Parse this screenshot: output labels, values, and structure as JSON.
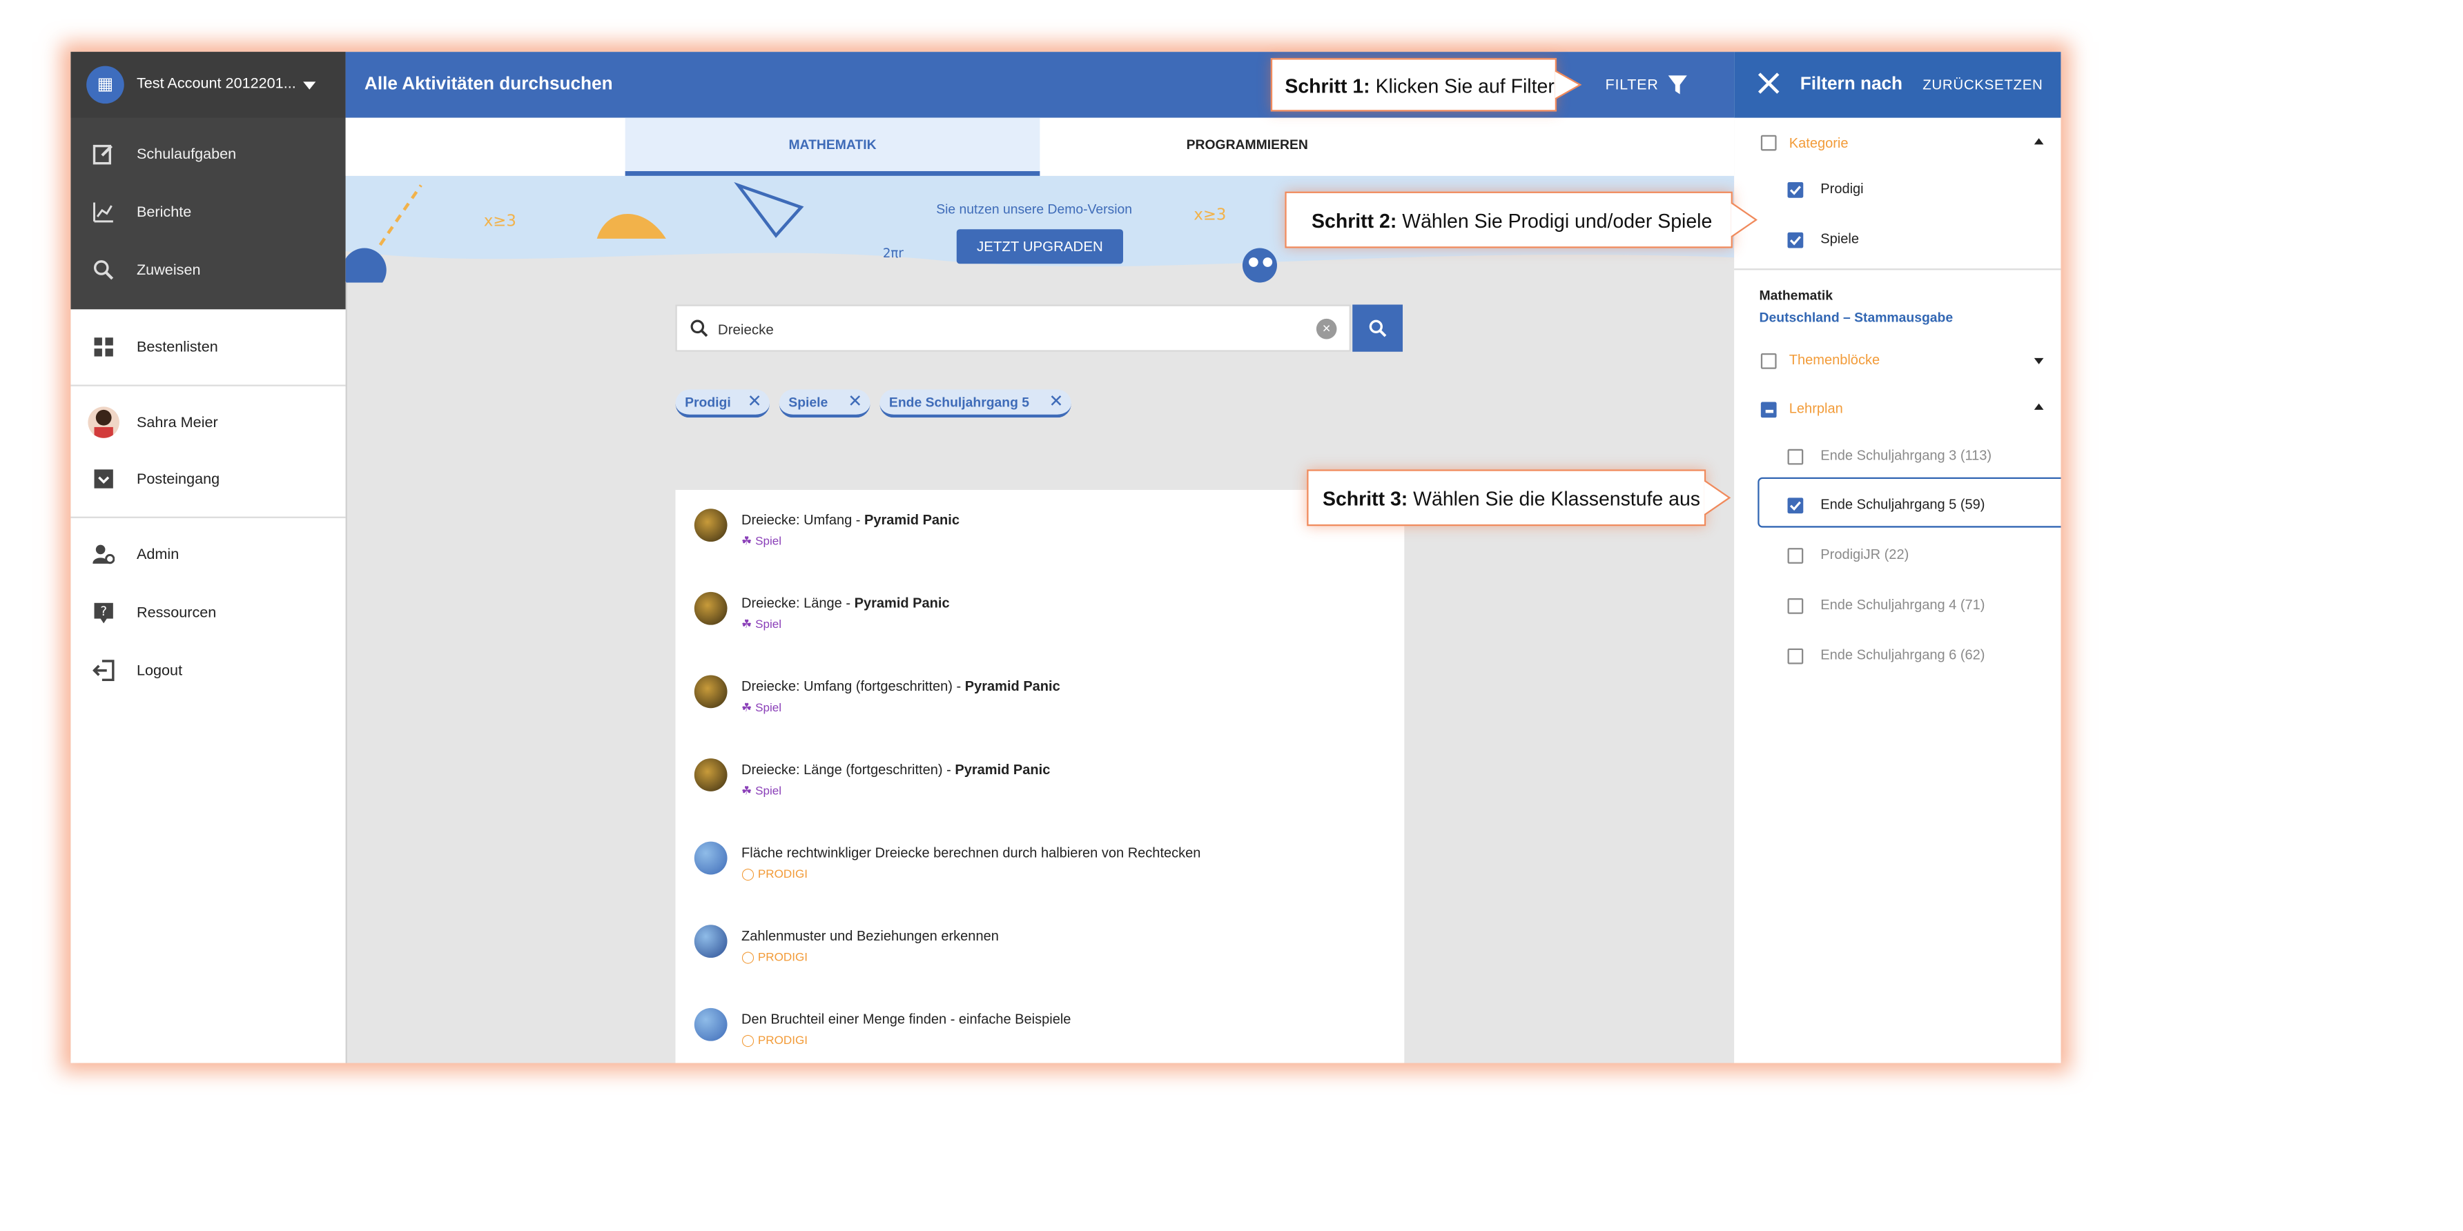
{
  "account": {
    "name": "Test Account 2012201..."
  },
  "sidebar": {
    "items": [
      {
        "label": "Schulaufgaben",
        "icon": "edit-icon"
      },
      {
        "label": "Berichte",
        "icon": "chart-icon"
      },
      {
        "label": "Zuweisen",
        "icon": "search-icon"
      },
      {
        "label": "Bestenlisten",
        "icon": "grid-icon"
      },
      {
        "label": "Sahra Meier",
        "icon": "avatar"
      },
      {
        "label": "Posteingang",
        "icon": "inbox-icon"
      },
      {
        "label": "Admin",
        "icon": "admin-icon"
      },
      {
        "label": "Ressourcen",
        "icon": "help-icon"
      },
      {
        "label": "Logout",
        "icon": "logout-icon"
      }
    ]
  },
  "header": {
    "title": "Alle Aktivitäten durchsuchen",
    "filter_label": "FILTER"
  },
  "tabs": [
    {
      "label": "MATHEMATIK"
    },
    {
      "label": "PROGRAMMIEREN"
    }
  ],
  "banner": {
    "text": "Sie nutzen unsere Demo-Version",
    "button": "JETZT UPGRADEN"
  },
  "search": {
    "value": "Dreiecke"
  },
  "chips": [
    {
      "label": "Prodigi"
    },
    {
      "label": "Spiele"
    },
    {
      "label": "Ende Schuljahrgang 5"
    }
  ],
  "results": [
    {
      "title": "Dreiecke: Umfang - ",
      "bold": "Pyramid Panic",
      "tag": "Spiel"
    },
    {
      "title": "Dreiecke: Länge - ",
      "bold": "Pyramid Panic",
      "tag": "Spiel"
    },
    {
      "title": "Dreiecke: Umfang (fortgeschritten) - ",
      "bold": "Pyramid Panic",
      "tag": "Spiel"
    },
    {
      "title": "Dreiecke: Länge (fortgeschritten) - ",
      "bold": "Pyramid Panic",
      "tag": "Spiel"
    },
    {
      "title": "Fläche rechtwinkliger Dreiecke berechnen durch halbieren von Rechtecken",
      "bold": "",
      "tag": "PRODIGI"
    },
    {
      "title": "Zahlenmuster und Beziehungen erkennen",
      "bold": "",
      "tag": "PRODIGI"
    },
    {
      "title": "Den Bruchteil einer Menge finden - einfache Beispiele",
      "bold": "",
      "tag": "PRODIGI"
    }
  ],
  "filter_panel": {
    "title": "Filtern nach",
    "reset": "ZURÜCKSETZEN",
    "kategorie": {
      "label": "Kategorie",
      "options": [
        {
          "label": "Prodigi",
          "checked": true
        },
        {
          "label": "Spiele",
          "checked": true
        }
      ]
    },
    "subject": {
      "name": "Mathematik",
      "edition": "Deutschland – Stammausgabe"
    },
    "themenbloecke": {
      "label": "Themenblöcke"
    },
    "lehrplan": {
      "label": "Lehrplan",
      "options": [
        {
          "label": "Ende Schuljahrgang 3 (113)",
          "checked": false
        },
        {
          "label": "Ende Schuljahrgang 5 (59)",
          "checked": true
        },
        {
          "label": "ProdigiJR (22)",
          "checked": false
        },
        {
          "label": "Ende Schuljahrgang 4 (71)",
          "checked": false
        },
        {
          "label": "Ende Schuljahrgang 6 (62)",
          "checked": false
        }
      ]
    }
  },
  "callouts": [
    {
      "step": "Schritt 1:",
      "text": " Klicken Sie auf Filter"
    },
    {
      "step": "Schritt 2:",
      "text": " Wählen Sie Prodigi und/oder Spiele"
    },
    {
      "step": "Schritt 3:",
      "text": " Wählen Sie die Klassenstufe aus"
    }
  ],
  "colors": {
    "primary": "#3e6bb8",
    "sidebar_dark": "#444444",
    "accent_orange": "#f29b38",
    "spiel_purple": "#8a3fb8"
  }
}
